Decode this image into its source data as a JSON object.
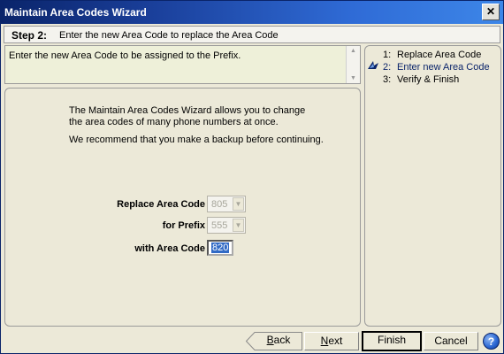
{
  "window": {
    "title": "Maintain Area Codes Wizard",
    "close_glyph": "✕"
  },
  "step_header": {
    "label": "Step 2:",
    "text": "Enter the new Area Code to replace the Area Code"
  },
  "description": {
    "text": "Enter the new Area Code to be assigned to the Prefix."
  },
  "intro": {
    "paragraph1": "The Maintain Area Codes Wizard allows you to change the area codes of many phone numbers at once.",
    "paragraph2": "We recommend that you make a backup before continuing."
  },
  "form": {
    "replace_label": "Replace Area Code",
    "replace_value": "805",
    "prefix_label": "for Prefix",
    "prefix_value": "555",
    "with_label": "with Area Code",
    "with_value": "820"
  },
  "steps": [
    {
      "num": "1:",
      "label": "Replace Area Code"
    },
    {
      "num": "2:",
      "label": "Enter new Area Code"
    },
    {
      "num": "3:",
      "label": "Verify & Finish"
    }
  ],
  "buttons": {
    "back_mnemonic": "B",
    "back_rest": "ack",
    "next_mnemonic": "N",
    "next_rest": "ext",
    "finish": "Finish",
    "cancel": "Cancel",
    "help_glyph": "?"
  },
  "colors": {
    "title_bar": "#0a246a",
    "description_bg": "#eef0d9",
    "active_step": "#0a246a",
    "selection": "#316ac5"
  },
  "icons": {
    "close": "close-icon",
    "active_step_marker": "arrow-marker-icon",
    "help": "help-icon",
    "combo_arrow": "chevron-down-icon"
  }
}
